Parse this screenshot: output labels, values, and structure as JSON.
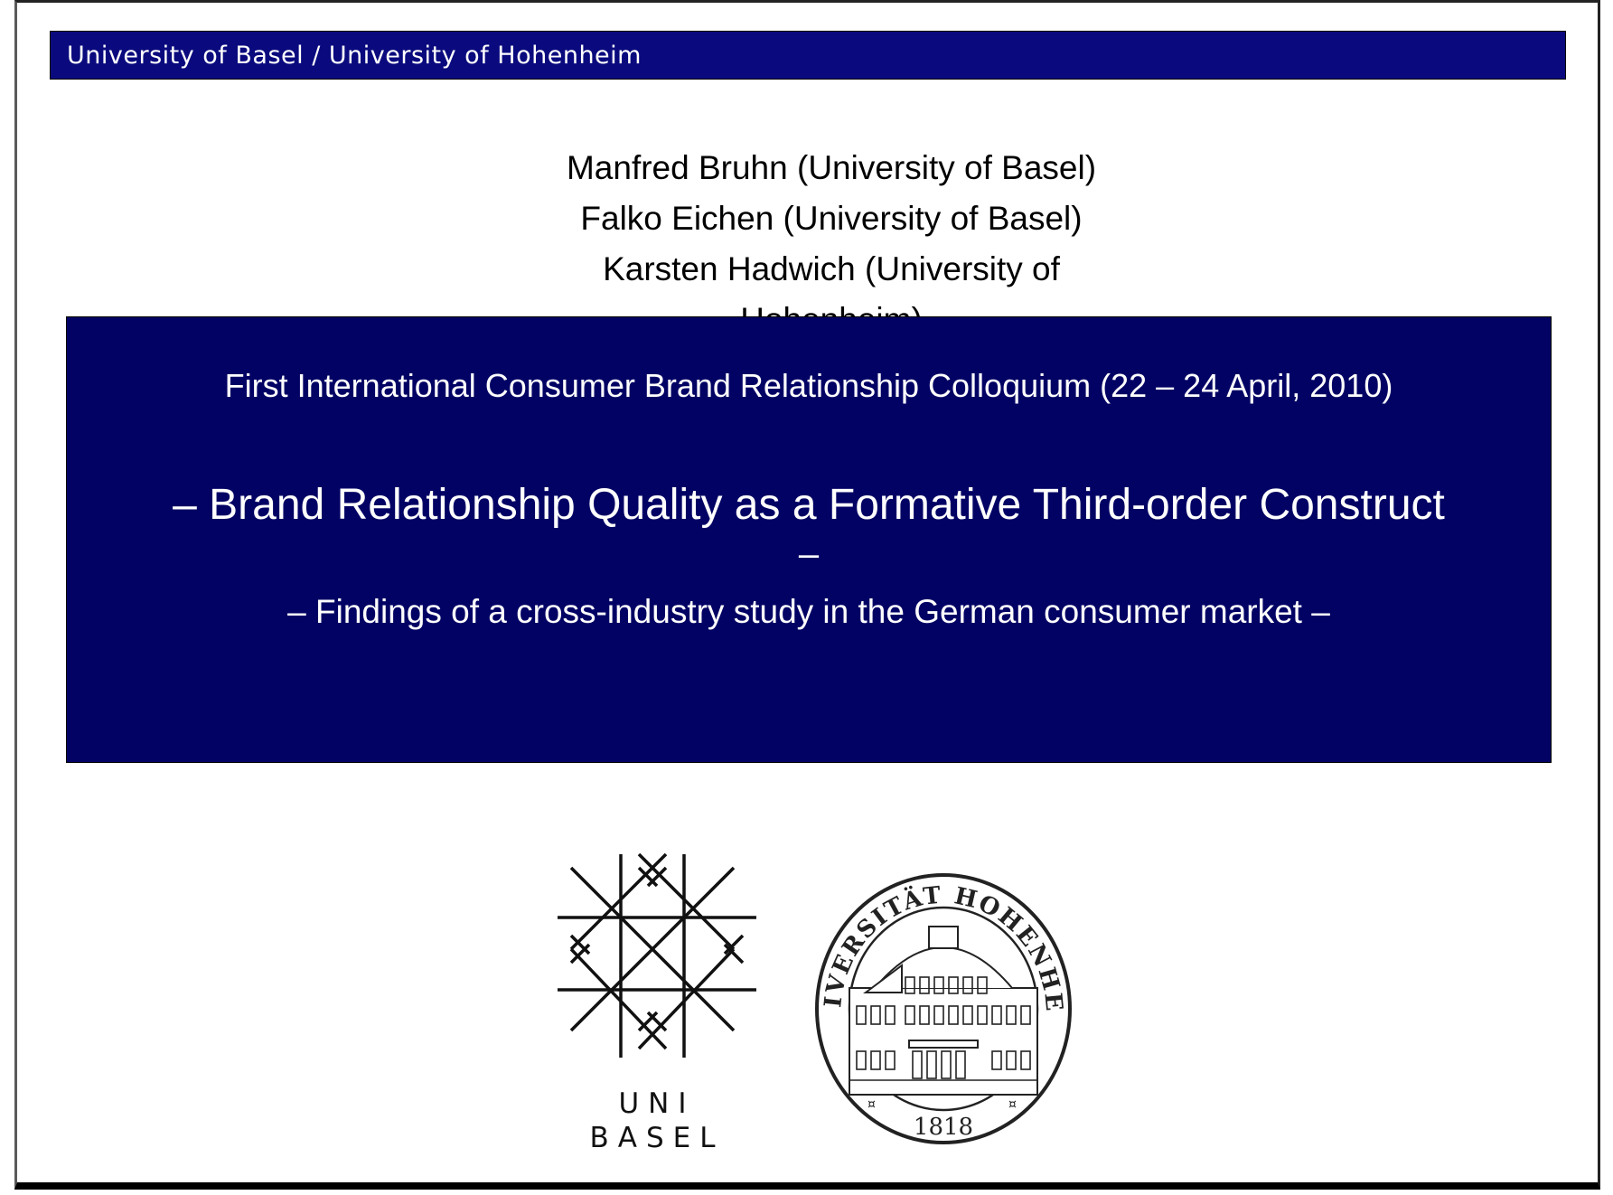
{
  "header": {
    "text": "University of Basel / University of Hohenheim"
  },
  "authors": [
    "Manfred Bruhn (University of Basel)",
    "Falko Eichen (University of Basel)",
    "Karsten Hadwich (University of",
    "Hohenheim)"
  ],
  "title_box": {
    "colloquium": "First International Consumer Brand Relationship Colloquium (22 – 24 April, 2010)",
    "main_title": "– Brand Relationship Quality as a Formative Third-order Construct",
    "dash": "–",
    "subtitle": "– Findings of a cross-industry study in the German consumer market –"
  },
  "logos": {
    "basel_line1": "UNI",
    "basel_line2": "BASEL",
    "hohenheim_ring_text": "UNIVERSITÄT HOHENHEIM",
    "hohenheim_year": "1818"
  }
}
